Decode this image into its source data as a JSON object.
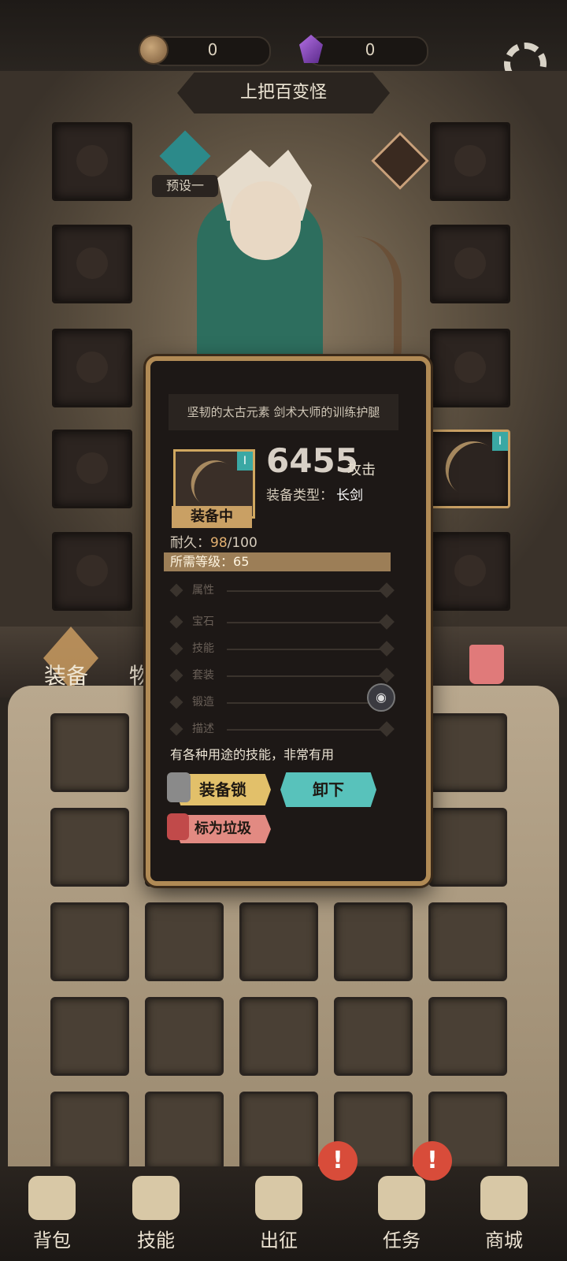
{
  "currency": {
    "coins": "0",
    "gems": "0"
  },
  "header": {
    "title": "上把百变怪",
    "preset_label": "预设一"
  },
  "tabs": {
    "equipment": "装备",
    "items": "物品"
  },
  "item_popup": {
    "title": "坚韧的太古元素 剑术大师的训练护腿",
    "tier": "I",
    "equipped_tag": "装备中",
    "stat_value": "6455",
    "stat_unit": "攻击",
    "type_label": "装备类型：",
    "type_value": "长剑",
    "durability_label": "耐久：",
    "durability_value": "98",
    "durability_max": "/100",
    "required_level_label": "所需等级：",
    "required_level_value": "65",
    "sections": [
      "属性",
      "宝石",
      "技能",
      "套装",
      "锻造",
      "描述"
    ],
    "description": "有各种用途的技能，非常有用",
    "buttons": {
      "lock": "装备锁",
      "unequip": "卸下",
      "mark_trash": "标为垃圾"
    }
  },
  "equipped_right_slot_tier": "I",
  "bottom_nav": [
    {
      "label": "背包",
      "alert": false
    },
    {
      "label": "技能",
      "alert": false
    },
    {
      "label": "出征",
      "alert": true
    },
    {
      "label": "任务",
      "alert": true
    },
    {
      "label": "商城",
      "alert": false
    }
  ],
  "alert_glyph": "!",
  "eye_glyph": "◉",
  "colors": {
    "accent_gold": "#c9a064",
    "teal": "#58c2bb",
    "danger": "#e28a82",
    "alert": "#d84c3a"
  }
}
